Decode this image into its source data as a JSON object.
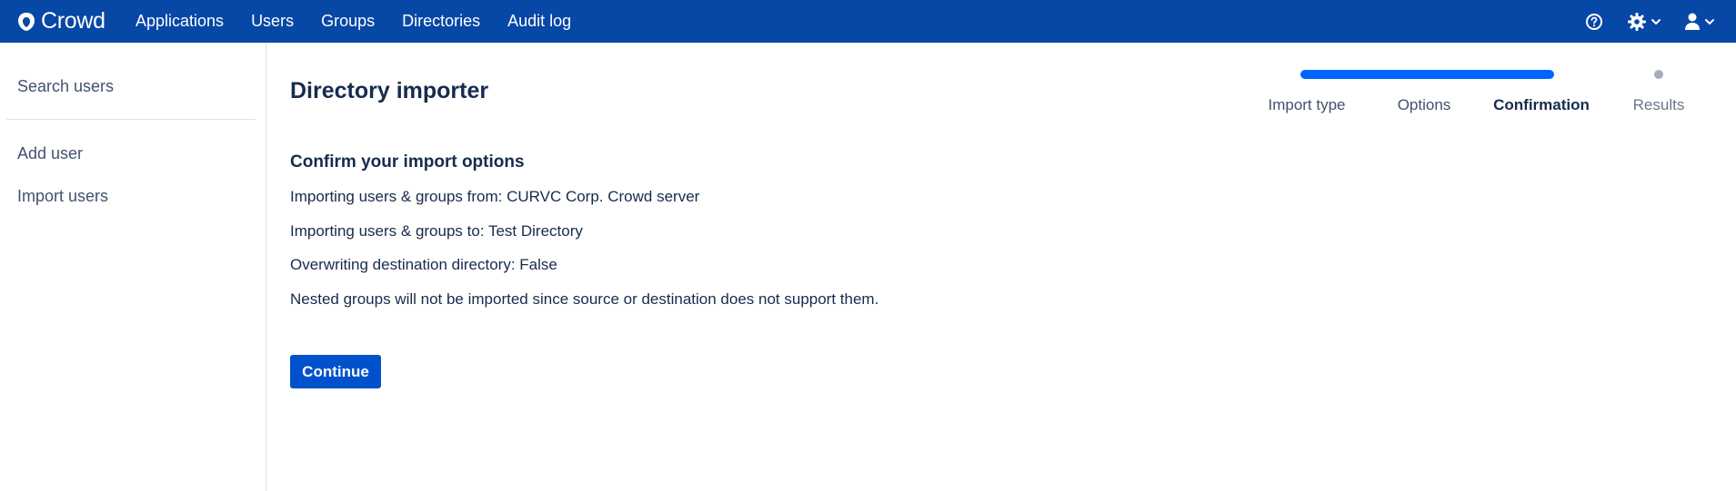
{
  "app": {
    "name": "Crowd",
    "logo_icon": "crowd-logo-icon",
    "colors": {
      "topbar": "#0747a6",
      "primary_button": "#0052cc",
      "progress": "#0065ff",
      "pending_dot": "#a5adba"
    }
  },
  "nav": {
    "items": [
      "Applications",
      "Users",
      "Groups",
      "Directories",
      "Audit log"
    ]
  },
  "top_icons": {
    "help": "help-icon",
    "settings": "gear-icon",
    "user": "user-icon",
    "dropdown": "chevron-down-icon"
  },
  "sidebar": {
    "items": [
      {
        "label": "Search users"
      },
      {
        "label": "Add user"
      },
      {
        "label": "Import users"
      }
    ]
  },
  "main": {
    "title": "Directory importer",
    "section_title": "Confirm your import options",
    "lines": [
      "Importing users & groups from: CURVC Corp. Crowd server",
      "Importing users & groups to: Test Directory",
      "Overwriting destination directory: False",
      "Nested groups will not be imported since source or destination does not support them."
    ],
    "continue_label": "Continue"
  },
  "progress_tracker": {
    "steps": [
      {
        "label": "Import type",
        "state": "completed"
      },
      {
        "label": "Options",
        "state": "completed"
      },
      {
        "label": "Confirmation",
        "state": "current"
      },
      {
        "label": "Results",
        "state": "pending"
      }
    ]
  }
}
